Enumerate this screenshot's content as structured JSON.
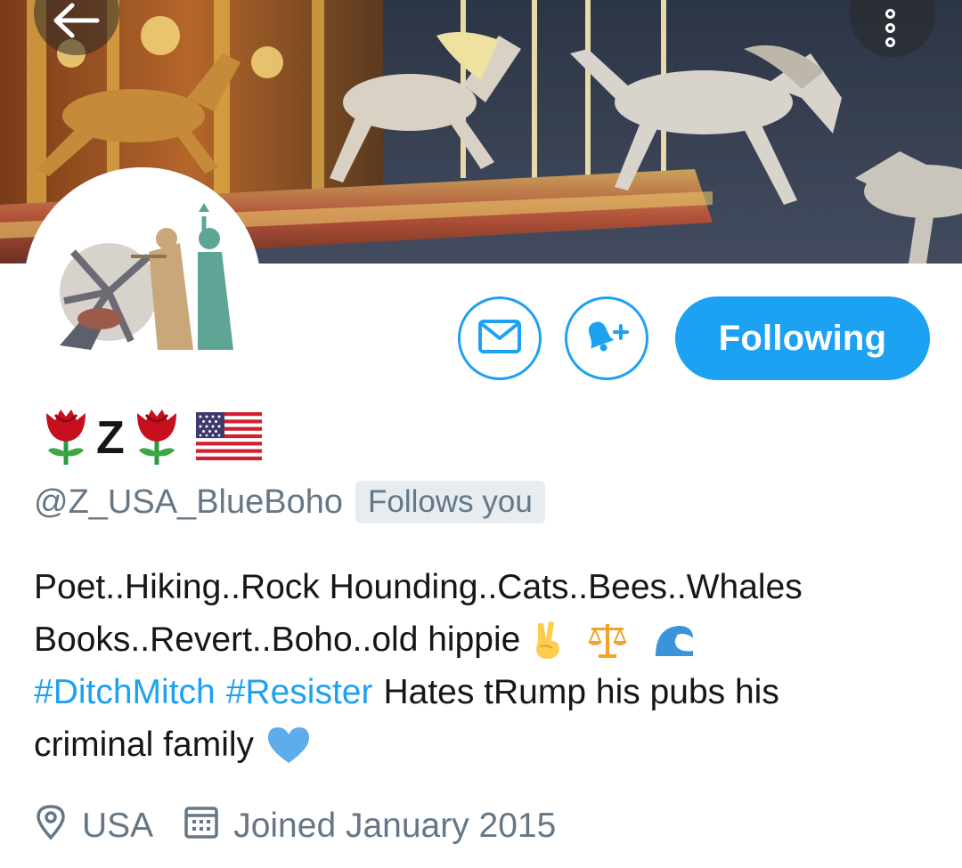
{
  "header": {
    "back_icon": "arrow-left-icon",
    "more_icon": "more-vertical-icon"
  },
  "profile": {
    "display_name_letter": "Z",
    "handle": "@Z_USA_BlueBoho",
    "follows_you": "Follows you",
    "bio_line1": "Poet..Hiking..Rock Hounding..Cats..Bees..Whales",
    "bio_line2": "Books..Revert..Boho..old hippie",
    "bio_hashtag1": "#DitchMitch",
    "bio_hashtag2": "#Resister",
    "bio_line3_rest": "Hates tRump his pubs his",
    "bio_line4": "criminal family",
    "location": "USA",
    "joined": "Joined January 2015"
  },
  "actions": {
    "message_icon": "envelope-icon",
    "notify_icon": "bell-plus-icon",
    "following_label": "Following"
  },
  "colors": {
    "accent": "#1da1f2",
    "muted": "#657786",
    "text": "#14171a"
  }
}
